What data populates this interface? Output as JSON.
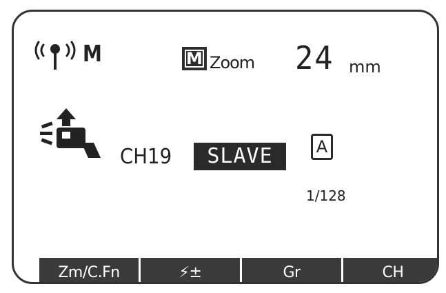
{
  "display": {
    "wireless_icon": "radio-wireless-icon",
    "mode": "M",
    "zoom_mode_badge": "M",
    "zoom_label": "Zoom",
    "zoom_value": "24",
    "zoom_unit": "mm",
    "slave_icon": "slave-flash-icon",
    "channel": "CH19",
    "role": "SLAVE",
    "group": "A",
    "power": "1/128"
  },
  "softkeys": [
    {
      "label": "Zm/C.Fn"
    },
    {
      "label": "⚡±"
    },
    {
      "label": "Gr"
    },
    {
      "label": "CH"
    }
  ],
  "colors": {
    "lcd_background": "#ffffff",
    "ink": "#222222",
    "softkey_background": "#3a3a3a",
    "softkey_text": "#ffffff"
  }
}
